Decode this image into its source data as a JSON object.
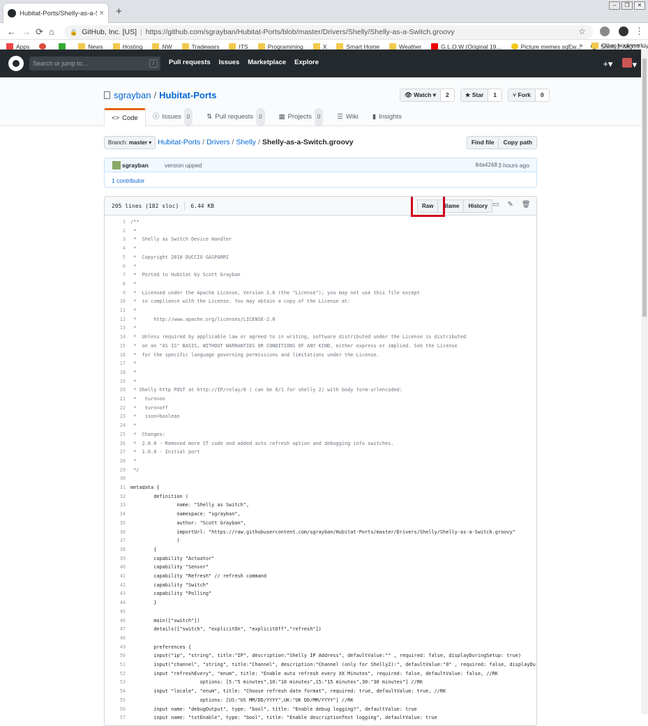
{
  "browser": {
    "tab_title": "Hubitat-Ports/Shelly-as-a-Switch.gr",
    "tab_close": "×",
    "new_tab": "+",
    "site_name": "GitHub, Inc. [US]",
    "url": "https://github.com/sgrayban/Hubitat-Ports/blob/master/Drivers/Shelly/Shelly-as-a-Switch.groovy",
    "bookmarks": [
      "Apps",
      "",
      "",
      "News",
      "Hosting",
      "NW",
      "Tradewars",
      "ITS",
      "Programming",
      "X",
      "Smart Home",
      "Weather",
      "G.L.O.W (Original 19...",
      "Picture memes sqEw...",
      "Shelly2: MQTT – API..."
    ],
    "bookmarks_more": "»",
    "other_bookmarks": "Other bookmarks"
  },
  "header": {
    "search_placeholder": "Search or jump to...",
    "search_key": "/",
    "nav": [
      "Pull requests",
      "Issues",
      "Marketplace",
      "Explore"
    ]
  },
  "repo": {
    "owner": "sgrayban",
    "name": "Hubitat-Ports",
    "watch_label": "Watch ▾",
    "watch_count": "2",
    "star_label": "Star",
    "star_count": "1",
    "fork_label": "Fork",
    "fork_count": "0",
    "tabs": [
      {
        "label": "Code",
        "count": ""
      },
      {
        "label": "Issues",
        "count": "0"
      },
      {
        "label": "Pull requests",
        "count": "0"
      },
      {
        "label": "Projects",
        "count": "0"
      },
      {
        "label": "Wiki",
        "count": ""
      },
      {
        "label": "Insights",
        "count": ""
      }
    ]
  },
  "filenav": {
    "branch_prefix": "Branch:",
    "branch": "master",
    "crumbs": [
      "Hubitat-Ports",
      "Drivers",
      "Shelly"
    ],
    "current_file": "Shelly-as-a-Switch.groovy",
    "find_file": "Find file",
    "copy_path": "Copy path"
  },
  "commit": {
    "author": "sgrayban",
    "message": "version upped",
    "sha": "0da4268",
    "when": "3 hours ago",
    "contributors": "1 contributor"
  },
  "file": {
    "lines_info": "205 lines (182 sloc)",
    "size": "6.44 KB",
    "raw": "Raw",
    "blame": "Blame",
    "history": "History"
  },
  "code_lines": [
    "/**",
    " *",
    " *  Shelly as Switch Device Handler",
    " *",
    " *  Copyright 2018 DUCCIO GASPARRI",
    " *",
    " *  Ported to Hubitat by Scott Grayban",
    " *",
    " *  Licensed under the Apache License, Version 2.0 (the \"License\"); you may not use this file except",
    " *  in compliance with the License. You may obtain a copy of the License at:",
    " *",
    " *      http://www.apache.org/licenses/LICENSE-2.0",
    " *",
    " *  Unless required by applicable law or agreed to in writing, software distributed under the License is distributed",
    " *  on an \"AS IS\" BASIS, WITHOUT WARRANTIES OR CONDITIONS OF ANY KIND, either express or implied. See the License",
    " *  for the specific language governing permissions and limitations under the License.",
    " *",
    " *",
    " *",
    " * Shelly http POST at http://IP/relay/0 ( can be 0/1 for shelly 2) with body form-urlencoded:",
    " *   turn=on",
    " *   turn=off",
    " *   ison=boolean",
    " *",
    " *  Changes:",
    " *  2.0.0 - Removed more ST code and added auto refresh option and debugging info switches.",
    " *  1.0.0 - Initial port",
    " *",
    " */",
    "",
    "metadata {",
    "        definition (",
    "                name: \"Shelly as Switch\",",
    "                namespace: \"sgrayban\",",
    "                author: \"Scott Grayban\",",
    "                importUrl: \"https://raw.githubusercontent.com/sgrayban/Hubitat-Ports/master/Drivers/Shelly/Shelly-as-a-Switch.groovy\"",
    "                )",
    "        {",
    "        capability \"Actuator\"",
    "        capability \"Sensor\"",
    "        capability \"Refresh\" // refresh command",
    "        capability \"Switch\"",
    "        capability \"Polling\"",
    "        }",
    "",
    "        main([\"switch\"])",
    "        details([\"switch\", \"explicitOn\", \"explicitOff\",\"refresh\"])",
    "",
    "        preferences {",
    "        input(\"ip\", \"string\", title:\"IP\", description:\"Shelly IP Address\", defaultValue:\"\" , required: false, displayDuringSetup: true)",
    "        input(\"channel\", \"string\", title:\"Channel\", description:\"Channel (only for Shelly2):\", defaultValue:\"0\" , required: false, displayDuringSetup: true)",
    "        input \"refreshEvery\", \"enum\", title: \"Enable auto refresh every XX Minutes\", required: false, defaultValue: false, //RK",
    "                        options: [5:\"5 minutes\",10:\"10 minutes\",15:\"15 minutes\",30:\"30 minutes\"] //RK",
    "        input \"locale\", \"enum\", title: \"Choose refresh date format\", required: true, defaultValue: true, //RK",
    "                        options: [US:\"US MM/DD/YYYY\",UK:\"UK DD/MM/YYYY\"] //RK",
    "        input name: \"debugOutput\", type: \"bool\", title: \"Enable debug logging?\", defaultValue: true",
    "        input name: \"txtEnable\", type: \"bool\", title: \"Enable descriptionText logging\", defaultValue: true"
  ]
}
